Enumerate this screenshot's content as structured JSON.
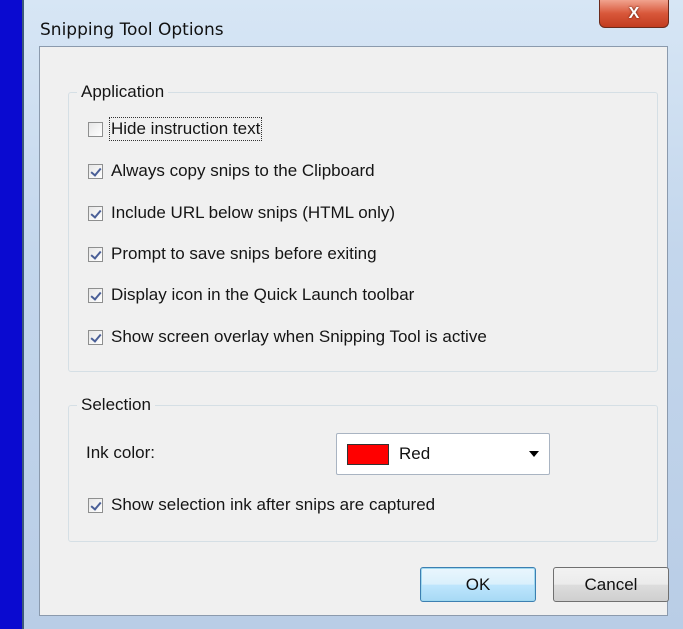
{
  "window": {
    "title": "Snipping Tool Options",
    "close_glyph": "X"
  },
  "application": {
    "label": "Application",
    "options": [
      {
        "label": "Hide instruction text",
        "checked": false
      },
      {
        "label": "Always copy snips to the Clipboard",
        "checked": true
      },
      {
        "label": "Include URL below snips (HTML only)",
        "checked": true
      },
      {
        "label": "Prompt to save snips before exiting",
        "checked": true
      },
      {
        "label": "Display icon in the Quick Launch toolbar",
        "checked": true
      },
      {
        "label": "Show screen overlay when Snipping Tool is active",
        "checked": true
      }
    ]
  },
  "selection": {
    "label": "Selection",
    "ink_color_label": "Ink color:",
    "ink_color_value": "Red",
    "ink_color_swatch": "#ff0000",
    "show_ink_label": "Show selection ink after snips are captured",
    "show_ink_checked": true
  },
  "buttons": {
    "ok": "OK",
    "cancel": "Cancel"
  }
}
